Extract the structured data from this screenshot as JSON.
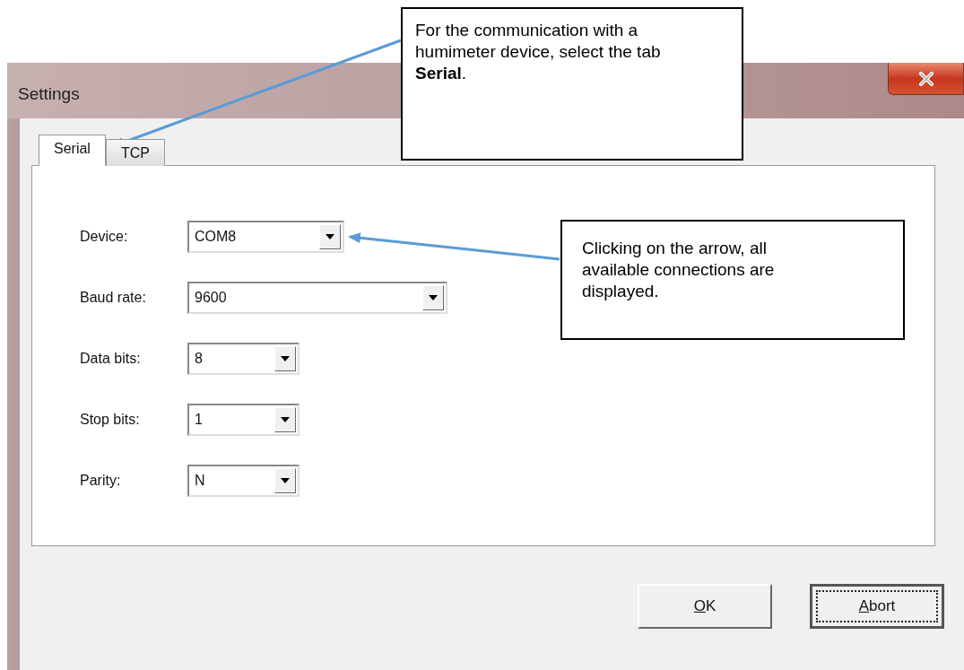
{
  "window": {
    "title": "Settings"
  },
  "tabs": [
    {
      "label": "Serial",
      "selected": true
    },
    {
      "label": "TCP",
      "selected": false
    }
  ],
  "fields": [
    {
      "label": "Device:",
      "value": "COM8"
    },
    {
      "label": "Baud rate:",
      "value": "9600"
    },
    {
      "label": "Data bits:",
      "value": "8"
    },
    {
      "label": "Stop bits:",
      "value": "1"
    },
    {
      "label": "Parity:",
      "value": "N"
    }
  ],
  "buttons": [
    {
      "label": "OK",
      "underline_first": true,
      "focused": false
    },
    {
      "label": "Abort",
      "underline_first": true,
      "focused": true
    }
  ],
  "callouts": [
    {
      "text": "For the communication with a humimeter device, select the tab **Serial**."
    },
    {
      "text": "Clicking on the arrow, all available connections are displayed."
    }
  ]
}
